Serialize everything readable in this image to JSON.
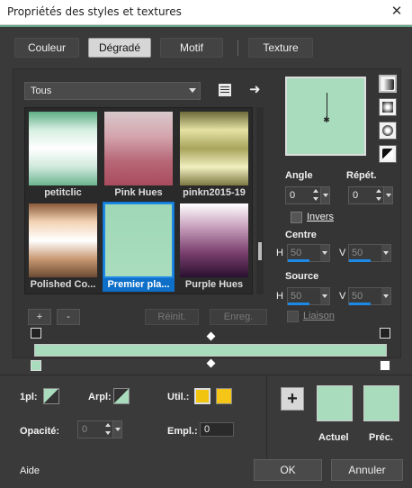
{
  "window": {
    "title": "Propriétés des styles et textures",
    "close_icon": "close-icon"
  },
  "tabs": [
    {
      "label": "Couleur",
      "active": false
    },
    {
      "label": "Dégradé",
      "active": true
    },
    {
      "label": "Motif",
      "active": false
    },
    {
      "label": "Texture",
      "active": false
    }
  ],
  "filter": {
    "selected": "Tous"
  },
  "gradients": [
    {
      "name": "petitclic",
      "colors": [
        "#5fae86",
        "#d7efe2",
        "#ffffff",
        "#cfe9dc",
        "#6bb48f"
      ]
    },
    {
      "name": "Pink Hues",
      "colors": [
        "#d8c8cc",
        "#d4a5ad",
        "#b86878",
        "#a84b5e"
      ]
    },
    {
      "name": "pinkn2015-19",
      "colors": [
        "#6e6a3a",
        "#e5e2a4",
        "#a8a35c",
        "#f2efc0",
        "#7d7842"
      ]
    },
    {
      "name": "Polished Co...",
      "colors": [
        "#8a5a3a",
        "#f3d3b4",
        "#ffffff",
        "#c99a74",
        "#6b4a32"
      ]
    },
    {
      "name": "Premier pla...",
      "colors": [
        "#9fd8b6",
        "#a9dcbd"
      ],
      "selected": true
    },
    {
      "name": "Purple Hues",
      "colors": [
        "#ffffff",
        "#c49bb9",
        "#7a3f6e",
        "#2a1030"
      ]
    }
  ],
  "list_buttons": {
    "add": "+",
    "remove": "-",
    "reset": "Réinit.",
    "save": "Enreg."
  },
  "preview": {
    "color": "#a9dcbd"
  },
  "style_buttons": [
    "linear",
    "radial",
    "rectangular",
    "sunburst"
  ],
  "angle": {
    "label": "Angle",
    "value": "0"
  },
  "repeat": {
    "label": "Répét.",
    "value": "0"
  },
  "invert": {
    "label": "Invers",
    "checked": false
  },
  "center": {
    "label": "Centre",
    "h_label": "H",
    "h_value": "50",
    "v_label": "V",
    "v_value": "50"
  },
  "source": {
    "label": "Source",
    "h_label": "H",
    "h_value": "50",
    "v_label": "V",
    "v_value": "50"
  },
  "link": {
    "label": "Liaison",
    "checked": false
  },
  "editor": {
    "bar_color": "#a9dcbd"
  },
  "stop_props": {
    "first_label": "1pl:",
    "bgplan_label": "Arpl:",
    "util_label": "Util.:",
    "opacity_label": "Opacité:",
    "opacity_value": "0",
    "location_label": "Empl.:",
    "location_value": "0",
    "util_colors": [
      "#f1c40f",
      "#f5c518"
    ]
  },
  "current": {
    "label": "Actuel",
    "color": "#a9dcbd"
  },
  "previous": {
    "label": "Préc.",
    "color": "#a9dcbd"
  },
  "footer": {
    "help": "Aide",
    "ok": "OK",
    "cancel": "Annuler"
  }
}
